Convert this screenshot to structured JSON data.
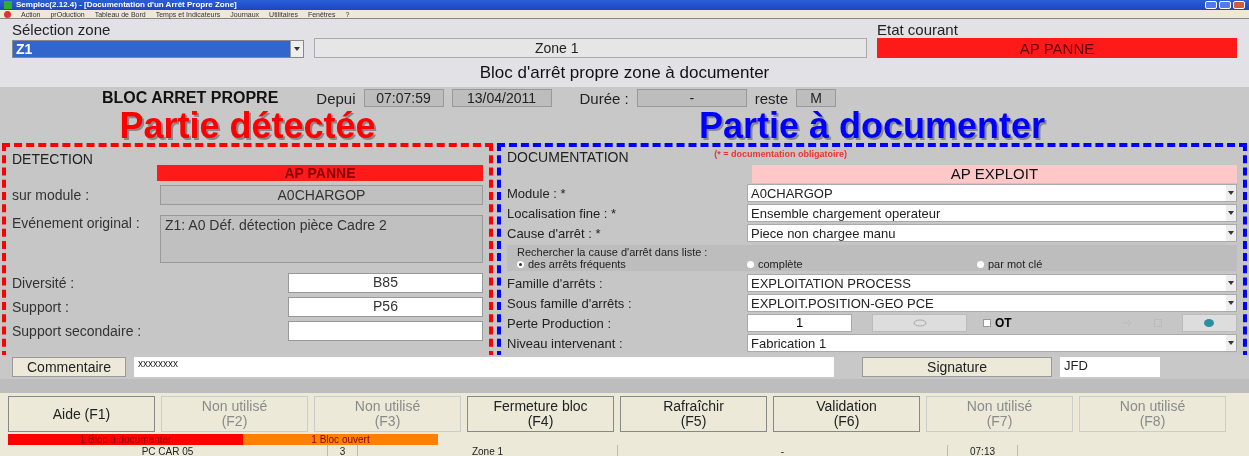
{
  "window": {
    "title": "Semploc(2.12.4) - [Documentation d'un Arrêt Propre Zone]"
  },
  "menu": [
    "Action",
    "prOduction",
    "Tableau de Bord",
    "Temps et Indicateurs",
    "Journaux",
    "Utilitaires",
    "Fenêtres",
    "?"
  ],
  "zone_selection": {
    "label": "Sélection zone",
    "value": "Z1",
    "zone_name": "Zone 1"
  },
  "current_state": {
    "label": "Etat courant",
    "value": "AP PANNE"
  },
  "banner": "Bloc d'arrêt propre zone à documenter",
  "block_header": {
    "title": "BLOC ARRET PROPRE",
    "since_label": "Depui",
    "time": "07:07:59",
    "date": "13/04/2011",
    "duration_label": "Durée :",
    "duration": "-",
    "remaining_label": "reste",
    "remaining": "M"
  },
  "annotations": [
    {
      "text": "Partie détectée",
      "color": "#ff0000"
    },
    {
      "text": "Partie à documenter",
      "color": "#0000ff"
    }
  ],
  "detection": {
    "title": "DETECTION",
    "state": "AP PANNE",
    "fields": [
      {
        "label": "sur module :",
        "value": "A0CHARGOP",
        "kind": "readonly"
      },
      {
        "label": "Evénement original :",
        "value": "Z1: A0 Déf. détection pièce Cadre 2",
        "kind": "multiline"
      },
      {
        "label": "Diversité :",
        "value": "B85",
        "kind": "input"
      },
      {
        "label": "Support :",
        "value": "P56",
        "kind": "input"
      },
      {
        "label": "Support secondaire :",
        "kind": "input"
      }
    ]
  },
  "documentation": {
    "title": "DOCUMENTATION",
    "note": "(* = documentation obligatoire)",
    "state": "AP EXPLOIT",
    "rows": [
      {
        "kind": "select",
        "label": "Module : *",
        "value": "A0CHARGOP"
      },
      {
        "kind": "select",
        "label": "Localisation fine : *",
        "value": "Ensemble chargement operateur"
      },
      {
        "kind": "select",
        "label": "Cause d'arrêt : *",
        "value": "Piece non chargee manu"
      },
      {
        "kind": "search",
        "label": "Rechercher la cause d'arrêt dans liste :",
        "options": [
          {
            "label": "des arrêts fréquents",
            "selected": true
          },
          {
            "label": "complète",
            "selected": false
          },
          {
            "label": "par mot clé",
            "selected": false
          }
        ]
      },
      {
        "kind": "select",
        "label": "Famille d'arrêts :",
        "value": "EXPLOITATION PROCESS"
      },
      {
        "kind": "select",
        "label": "Sous famille d'arrêts :",
        "value": "EXPLOIT.POSITION-GEO PCE"
      },
      {
        "kind": "loss",
        "label": "Perte Production :",
        "value": "1",
        "ot": {
          "label": "OT",
          "checked": false
        }
      },
      {
        "kind": "select",
        "label": "Niveau intervenant :",
        "value": "Fabrication 1"
      }
    ]
  },
  "comment": {
    "button": "Commentaire",
    "value": "xxxxxxxx"
  },
  "signature": {
    "button": "Signature",
    "value": "JFD"
  },
  "function_keys": [
    {
      "label": "Aide (F1)",
      "disabled": false
    },
    {
      "label": "Non utilisé",
      "key": "(F2)",
      "disabled": true
    },
    {
      "label": "Non utilisé",
      "key": "(F3)",
      "disabled": true
    },
    {
      "label": "Fermeture bloc",
      "key": "(F4)",
      "disabled": false
    },
    {
      "label": "Rafraîchir",
      "key": "(F5)",
      "disabled": false
    },
    {
      "label": "Validation",
      "key": "(F6)",
      "disabled": false
    },
    {
      "label": "Non utilisé",
      "key": "(F7)",
      "disabled": true
    },
    {
      "label": "Non utilisé",
      "key": "(F8)",
      "disabled": true
    }
  ],
  "indicators": [
    {
      "text": "1 Bloc à documenter",
      "color": "#ff0000"
    },
    {
      "text": "1 Bloc ouvert",
      "color": "#ff8000"
    }
  ],
  "status_bar": [
    "PC CAR 05",
    "3",
    "Zone 1",
    "-",
    "07:13"
  ]
}
